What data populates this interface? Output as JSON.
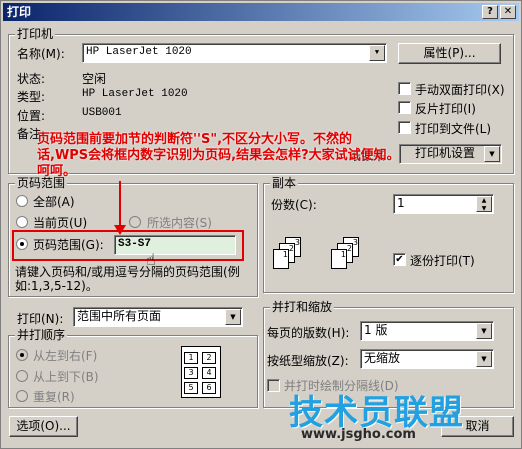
{
  "title": "打印",
  "printer": {
    "group_label": "打印机",
    "name_label": "名称(M):",
    "name_value": "HP LaserJet 1020",
    "props_button": "属性(P)...",
    "status_label": "状态:",
    "status_value": "空闲",
    "type_label": "类型:",
    "type_value": "HP LaserJet 1020",
    "location_label": "位置:",
    "location_value": "USB001",
    "comment_label": "备注:",
    "manual_duplex": "手动双面打印(X)",
    "reverse_print": "反片打印(I)",
    "print_to_file": "打印到文件(L)",
    "paper_source_partial": "纸张来",
    "printer_settings_partial": "打印机设置"
  },
  "annotation": "页码范围前要加节的判断符''S\",不区分大小写。不然的话,WPS会将框内数字识别为页码,结果会怎样?大家试试便知。呵呵。",
  "page_range": {
    "group_label": "页码范围",
    "all": "全部(A)",
    "current_page": "当前页(U)",
    "selection": "所选内容(S)",
    "pages": "页码范围(G):",
    "pages_value": "S3-S7",
    "hint": "请键入页码和/或用逗号分隔的页码范围(例如:1,3,5-12)。"
  },
  "print_what": {
    "label": "打印(N):",
    "value": "范围中所有页面"
  },
  "order": {
    "group_label": "并打顺序",
    "left_to_right": "从左到右(F)",
    "top_to_bottom": "从上到下(B)",
    "repeat": "重复(R)",
    "preview_numbers": [
      "1",
      "2",
      "3",
      "4",
      "5",
      "6"
    ]
  },
  "copies": {
    "group_label": "副本",
    "count_label": "份数(C):",
    "count_value": "1",
    "collate": "逐份打印(T)",
    "collate_checked": true
  },
  "zoom": {
    "group_label": "并打和缩放",
    "pages_per_sheet_label": "每页的版数(H):",
    "pages_per_sheet_value": "1 版",
    "scale_label": "按纸型缩放(Z):",
    "scale_value": "无缩放",
    "draw_border": "并打时绘制分隔线(D)"
  },
  "options_button": "选项(O)...",
  "cancel_partial": "取消",
  "watermark": {
    "brand": "技术员联盟",
    "url": "www.jsgho.com"
  }
}
